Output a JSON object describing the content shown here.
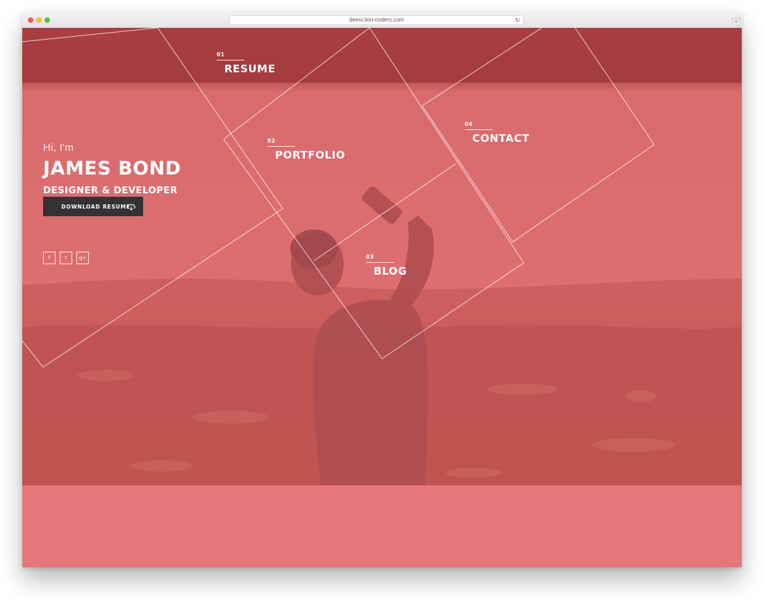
{
  "browser": {
    "url": "demo.lion-coders.com",
    "reload_icon": "reload-icon",
    "plus_label": "+"
  },
  "hero": {
    "greeting": "Hi, I'm",
    "name": "JAMES BOND",
    "role": "DESIGNER & DEVELOPER",
    "download_label": "DOWNLOAD RESUME",
    "download_icon": "cloud-download-icon"
  },
  "social": [
    {
      "label": "f",
      "icon": "facebook-icon"
    },
    {
      "label": "t",
      "icon": "twitter-icon"
    },
    {
      "label": "g+",
      "icon": "google-plus-icon"
    }
  ],
  "nav": [
    {
      "num": "01",
      "label": "RESUME"
    },
    {
      "num": "02",
      "label": "PORTFOLIO"
    },
    {
      "num": "03",
      "label": "BLOG"
    },
    {
      "num": "04",
      "label": "CONTACT"
    }
  ],
  "colors": {
    "overlay": "#e0707a",
    "button": "#333333",
    "text": "#ffffff"
  }
}
